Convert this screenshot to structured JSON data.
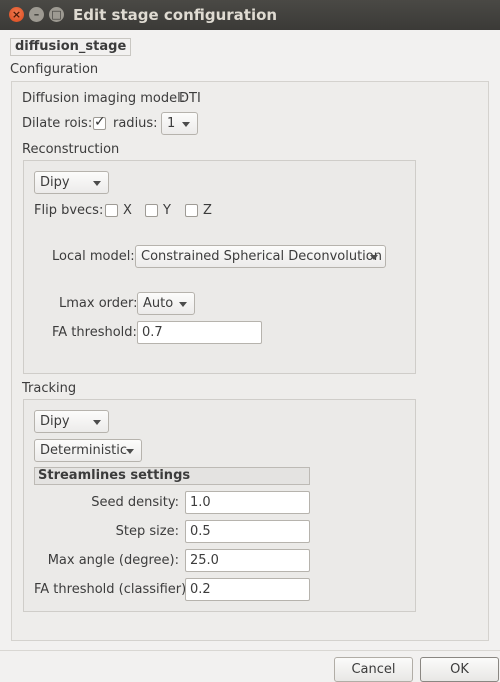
{
  "window": {
    "title": "Edit stage configuration"
  },
  "stage": {
    "name": "diffusion_stage"
  },
  "configuration": {
    "label": "Configuration",
    "diffusion_model_label": "Diffusion imaging model:",
    "diffusion_model_value": "DTI",
    "dilate_rois_label": "Dilate rois:",
    "dilate_rois_checked": true,
    "radius_label": "radius:",
    "radius_value": "1"
  },
  "reconstruction": {
    "label": "Reconstruction",
    "tool": "Dipy",
    "flip_bvecs_label": "Flip bvecs:",
    "flip_x": "X",
    "flip_y": "Y",
    "flip_z": "Z",
    "local_model_label": "Local model:",
    "local_model_value": "Constrained Spherical Deconvolution",
    "lmax_label": "Lmax order:",
    "lmax_value": "Auto",
    "fa_threshold_label": "FA threshold:",
    "fa_threshold_value": "0.7"
  },
  "tracking": {
    "label": "Tracking",
    "tool": "Dipy",
    "mode": "Deterministic",
    "streamlines_header": "Streamlines settings",
    "seed_density_label": "Seed density:",
    "seed_density_value": "1.0",
    "step_size_label": "Step size:",
    "step_size_value": "0.5",
    "max_angle_label": "Max angle (degree):",
    "max_angle_value": "25.0",
    "fa_threshold_label": "FA threshold (classifier):",
    "fa_threshold_value": "0.2"
  },
  "buttons": {
    "cancel": "Cancel",
    "ok": "OK"
  },
  "icons": {
    "close": "close-icon",
    "minimize": "minimize-icon",
    "maximize": "maximize-icon",
    "dropdown": "chevron-down-icon",
    "check": "checkmark-icon"
  },
  "colors": {
    "close_button": "#e05a2a",
    "titlebar": "#3f3e3a",
    "window_bg": "#f2f1f0"
  }
}
